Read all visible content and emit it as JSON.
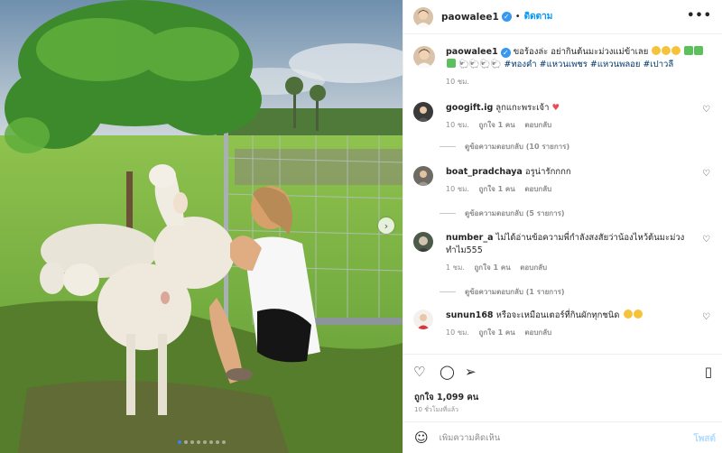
{
  "post": {
    "username": "paowalee1",
    "follow_label": "ติดตาม",
    "separator": "•",
    "more_label": "•••",
    "caption_text": "ขอร้องล่ะ อย่ากินต้นมะม่วงแม่ข้าเลย",
    "caption_tags": "#ทองคำ #แหวนเพชร #แหวนพลอย #เปาวลี",
    "caption_time": "10 ชม."
  },
  "comments": [
    {
      "username": "googift.ig",
      "text": "ลูกแกะพระเจ้า",
      "time": "10 ชม.",
      "likes": "ถูกใจ 1 คน",
      "reply": "ตอบกลับ",
      "replies_label": "ดูข้อความตอบกลับ (10 รายการ)"
    },
    {
      "username": "boat_pradchaya",
      "text": "อรูน่ารักกกก",
      "time": "10 ชม.",
      "likes": "ถูกใจ 1 คน",
      "reply": "ตอบกลับ",
      "replies_label": "ดูข้อความตอบกลับ (5 รายการ)"
    },
    {
      "username": "number_a",
      "text": "ไม่ได้อ่านข้อความพี่กำลังสงสัยว่าน้องไหว้ต้นมะม่วงทำไม555",
      "time": "1 ชม.",
      "likes": "ถูกใจ 1 คน",
      "reply": "ตอบกลับ",
      "replies_label": "ดูข้อความตอบกลับ (1 รายการ)"
    },
    {
      "username": "sunun168",
      "text": "หรือจะเหมือนเตอร์ที่กินผักทุกชนิด",
      "time": "10 ชม.",
      "likes": "ถูกใจ 1 คน",
      "reply": "ตอบกลับ"
    }
  ],
  "actions": {
    "like_icon": "heart-icon",
    "comment_icon": "comment-icon",
    "share_icon": "share-icon",
    "save_icon": "bookmark-icon",
    "likes_label": "ถูกใจ 1,099 คน",
    "time_ago": "10 ชั่วโมงที่แล้ว"
  },
  "add_comment": {
    "placeholder": "เพิ่มความคิดเห็น",
    "post_label": "โพสต์"
  },
  "colors": {
    "accent": "#0095f6",
    "verified": "#3897f0",
    "heart": "#ed4956"
  }
}
